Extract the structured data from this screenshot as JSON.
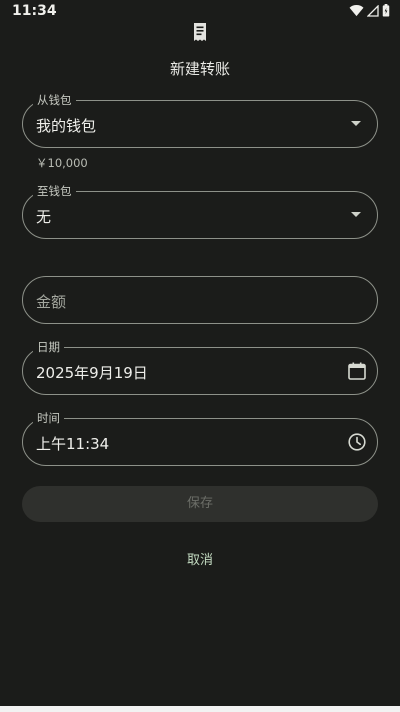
{
  "status_bar": {
    "time": "11:34",
    "icons": [
      "wifi-icon",
      "signal-icon",
      "battery-icon"
    ]
  },
  "dialog": {
    "icon": "receipt-icon",
    "title": "新建转账"
  },
  "from_wallet": {
    "label": "从钱包",
    "value": "我的钱包",
    "balance": "￥10,000"
  },
  "to_wallet": {
    "label": "至钱包",
    "value": "无"
  },
  "amount": {
    "placeholder": "金额"
  },
  "date": {
    "label": "日期",
    "value": "2025年9月19日"
  },
  "time": {
    "label": "时间",
    "value": "上午11:34"
  },
  "actions": {
    "save_label": "保存",
    "cancel_label": "取消"
  },
  "colors": {
    "background": "#1b1c1a",
    "outline": "#8d9189",
    "accent": "#c4dcc2",
    "disabled_button": "#2f302d"
  }
}
